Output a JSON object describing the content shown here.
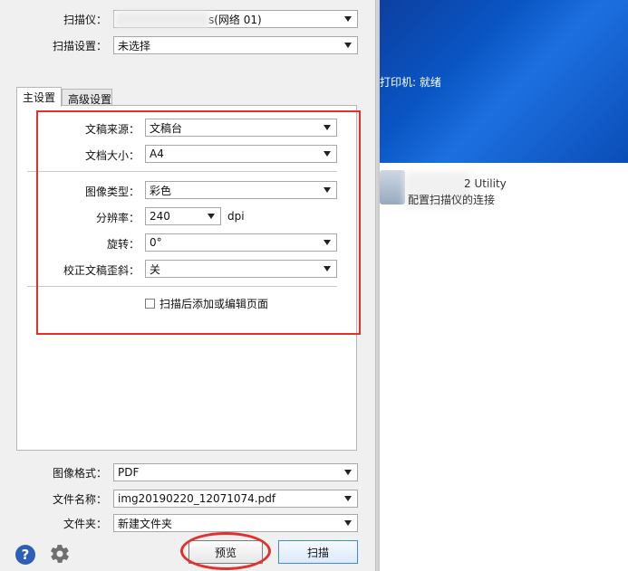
{
  "scanner": {
    "label": "扫描仪：",
    "value_visible": "s(网络 01)"
  },
  "scan_settings": {
    "label": "扫描设置：",
    "value": "未选择"
  },
  "tabs": [
    {
      "label": "主设置",
      "active": true
    },
    {
      "label": "高级设置",
      "active": false
    }
  ],
  "main_settings": {
    "doc_source": {
      "label": "文稿来源：",
      "value": "文稿台"
    },
    "doc_size": {
      "label": "文档大小：",
      "value": "A4"
    },
    "image_type": {
      "label": "图像类型：",
      "value": "彩色"
    },
    "resolution": {
      "label": "分辨率：",
      "value": "240",
      "unit": "dpi"
    },
    "rotation": {
      "label": "旋转：",
      "value": "0°"
    },
    "skew_correction": {
      "label": "校正文稿歪斜：",
      "value": "关"
    },
    "add_edit_pages": {
      "label": "扫描后添加或编辑页面",
      "checked": false
    }
  },
  "output": {
    "image_format": {
      "label": "图像格式：",
      "value": "PDF"
    },
    "file_name": {
      "label": "文件名称：",
      "value": "img20190220_12071074.pdf"
    },
    "folder": {
      "label": "文件夹：",
      "value": "新建文件夹"
    }
  },
  "buttons": {
    "preview": "预览",
    "scan": "扫描"
  },
  "desktop": {
    "status_text": "打印机: 就绪",
    "utility_title": "2 Utility",
    "utility_subtitle": "配置扫描仪的连接"
  },
  "icons": {
    "help": "question-mark-icon",
    "settings": "gear-icon"
  },
  "colors": {
    "annotation_red": "#e1302d",
    "primary_blue": "#3a8be8",
    "desktop_blue": "#0a56c5"
  }
}
